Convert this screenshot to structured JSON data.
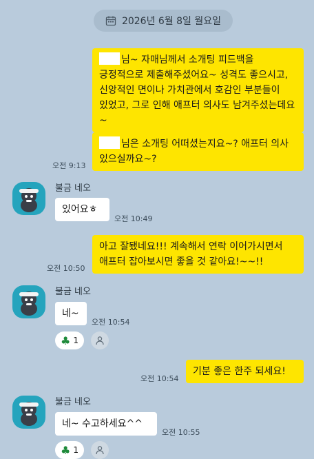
{
  "date_label": "2026년 6월 8일 월요일",
  "messages": {
    "m1": "님~ 자매님께서 소개팅 피드백을 긍정적으로 제출해주셨어요~ 성격도 좋으시고, 신앙적인 면이나 가치관에서 호감인 부분들이 있었고, 그로 인해 애프터 의사도 남겨주셨는데요~",
    "m2": "님은 소개팅 어떠셨는지요~? 애프터 의사 있으실까요~?",
    "t2": "오전 9:13",
    "r1": "있어요ㅎ",
    "rt1": "오전 10:49",
    "m3": "아고 잘됐네요!!! 계속해서 연락 이어가시면서 애프터 잡아보시면 좋을 것 같아요!~~!!",
    "t3": "오전 10:50",
    "r2": "네~",
    "rt2": "오전 10:54",
    "m4": "기분 좋은 한주 되세요!",
    "t4": "오전 10:54",
    "r3": "네~ 수고하세요^^",
    "rt3": "오전 10:55"
  },
  "sender": {
    "name": "불금 네오"
  },
  "reactions": {
    "r2_count": "1",
    "r3_count": "1",
    "icon": "clover-icon"
  },
  "colors": {
    "background": "#b9cbdc",
    "my_bubble": "#fee500",
    "their_bubble": "#ffffff",
    "avatar_bg": "#25a4bd"
  }
}
